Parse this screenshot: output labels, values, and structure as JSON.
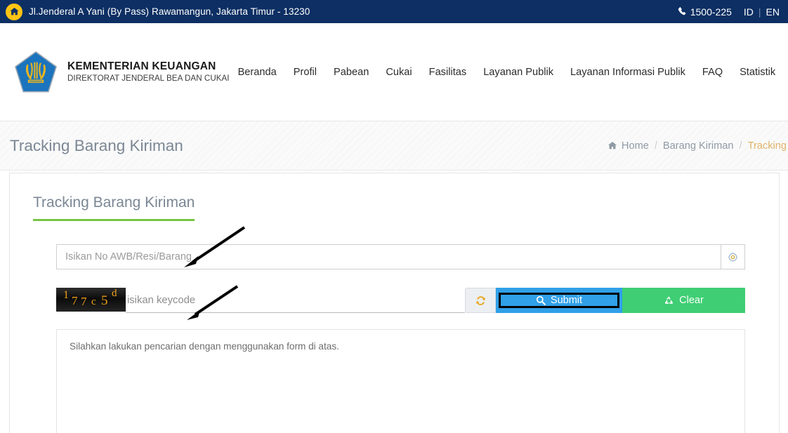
{
  "topbar": {
    "home_icon": "home-icon",
    "address": "Jl.Jenderal A Yani (By Pass) Rawamangun, Jakarta Timur - 13230",
    "phone_icon": "phone-icon",
    "phone": "1500-225",
    "lang_id": "ID",
    "lang_separator": "|",
    "lang_en": "EN"
  },
  "brand": {
    "logo_icon": "ministry-of-finance-logo",
    "line1": "KEMENTERIAN KEUANGAN",
    "line2": "DIREKTORAT JENDERAL BEA DAN CUKAI"
  },
  "nav": {
    "items": [
      {
        "label": "Beranda"
      },
      {
        "label": "Profil"
      },
      {
        "label": "Pabean"
      },
      {
        "label": "Cukai"
      },
      {
        "label": "Fasilitas"
      },
      {
        "label": "Layanan Publik"
      },
      {
        "label": "Layanan Informasi Publik"
      },
      {
        "label": "FAQ"
      },
      {
        "label": "Statistik"
      }
    ],
    "search_icon": "search-icon",
    "search_icon_color": "#e8453c"
  },
  "breadcrumb_band": {
    "title": "Tracking Barang Kiriman",
    "home_icon": "home-icon",
    "items": [
      {
        "label": "Home",
        "active": false
      },
      {
        "label": "Barang Kiriman",
        "active": false
      },
      {
        "label": "Tracking",
        "active": true
      }
    ],
    "separator": "/",
    "active_color": "#e0b266"
  },
  "card": {
    "title": "Tracking Barang Kiriman",
    "accent_color": "#76c442"
  },
  "form": {
    "awb_input": {
      "value": "",
      "placeholder": "Isikan No AWB/Resi/Barang"
    },
    "awb_addon_icon": "compass-icon",
    "captcha": {
      "characters": [
        "1",
        "7",
        "7",
        "c",
        "5",
        "d"
      ],
      "text": "177c5d",
      "text_color": "#f0a018"
    },
    "keycode_input": {
      "value": "",
      "placeholder": "isikan keycode"
    },
    "refresh_button": {
      "icon": "refresh-icon",
      "icon_color": "#e8a317",
      "label": ""
    },
    "submit_button": {
      "icon": "search-icon",
      "label": "Submit",
      "color": "#30a0e8"
    },
    "clear_button": {
      "icon": "recycle-icon",
      "label": "Clear",
      "color": "#3fce73"
    }
  },
  "result": {
    "message": "Silahkan lakukan pencarian dengan menggunakan form di atas."
  },
  "annotations": [
    {
      "name": "arrow-to-awb-input",
      "color": "#000000"
    },
    {
      "name": "arrow-to-keycode-input",
      "color": "#000000"
    }
  ]
}
